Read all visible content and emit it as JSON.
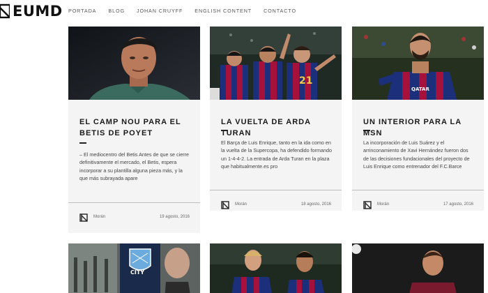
{
  "site": {
    "logo_text": "EUMD"
  },
  "nav": [
    "PORTADA",
    "BLOG",
    "JOHAN CRUYFF",
    "ENGLISH CONTENT",
    "CONTACTO"
  ],
  "posts": [
    {
      "title": "EL CAMP NOU PARA EL BETIS DE POYET",
      "excerpt": "– El mediocentro del Betis Antes de que se cierre definitivamente el mercado, el Betis, espera incorporar a su plantilla alguna pieza más, y la que más subrayada apare",
      "author": "Morán",
      "date": "19 agosto, 2016"
    },
    {
      "title": "LA VUELTA DE ARDA TURAN",
      "excerpt": "El Barça de Luis Enrique, tanto en la ida como en la vuelta de la Supercopa, ha defendido formando un 1-4-4-2. La entrada de Arda Turan en la plaza que habitualmente.es pro",
      "author": "Morán",
      "date": "18 agosto, 2016"
    },
    {
      "title": "UN INTERIOR PARA LA MSN",
      "excerpt": "La incorporación de Luis Suárez y el arrinconamiento de Xavi Hernández fueron dos de las decisiones fundacionales del proyecto de Luis Enrique como entrenador del F.C.Barce",
      "author": "Morán",
      "date": "17 agosto, 2016"
    }
  ],
  "thumbs": {
    "city_crest_text": "CITY",
    "shirt_number": "21",
    "qatar": "QATAR"
  },
  "colors": {
    "card_bg": "#f4f4f4",
    "barca_blue": "#1b2f7a",
    "barca_red": "#a5113a",
    "grass": "#2f4a2a"
  }
}
